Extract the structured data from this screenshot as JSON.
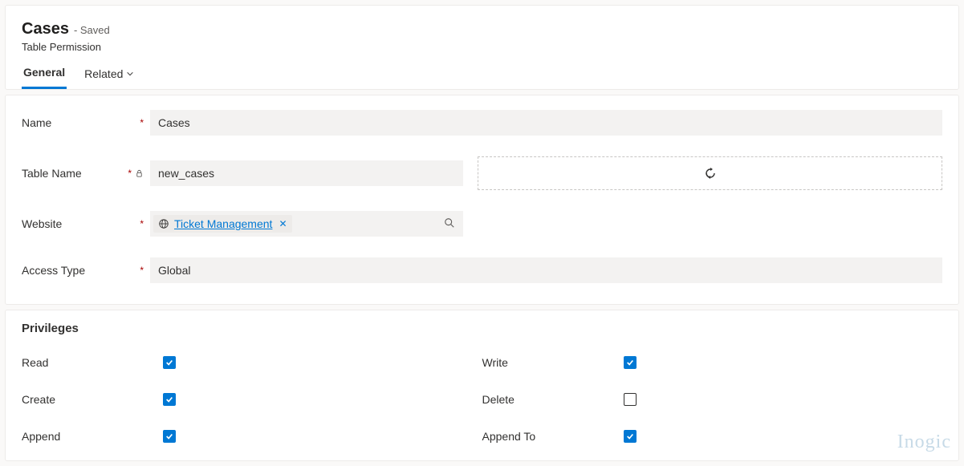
{
  "header": {
    "title": "Cases",
    "save_state": "- Saved",
    "subtitle": "Table Permission"
  },
  "tabs": {
    "general": "General",
    "related": "Related"
  },
  "form": {
    "name": {
      "label": "Name",
      "value": "Cases"
    },
    "table_name": {
      "label": "Table Name",
      "value": "new_cases"
    },
    "website": {
      "label": "Website",
      "value": "Ticket Management"
    },
    "access_type": {
      "label": "Access Type",
      "value": "Global"
    }
  },
  "privileges": {
    "title": "Privileges",
    "items": [
      {
        "label": "Read",
        "checked": true
      },
      {
        "label": "Write",
        "checked": true
      },
      {
        "label": "Create",
        "checked": true
      },
      {
        "label": "Delete",
        "checked": false
      },
      {
        "label": "Append",
        "checked": true
      },
      {
        "label": "Append To",
        "checked": true
      }
    ]
  },
  "watermark": "Inogic"
}
